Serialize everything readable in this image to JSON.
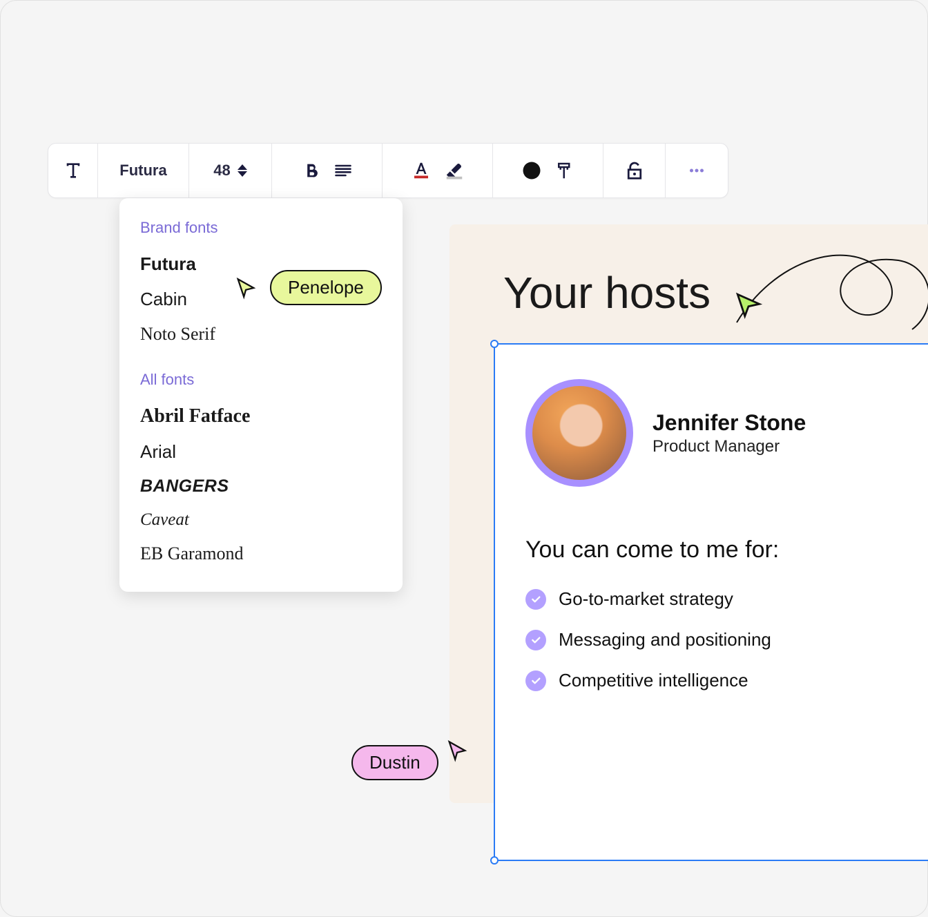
{
  "toolbar": {
    "font_label": "Futura",
    "font_size": "48"
  },
  "dropdown": {
    "brand_section": "Brand fonts",
    "brand_fonts": [
      "Futura",
      "Cabin",
      "Noto Serif"
    ],
    "all_section": "All fonts",
    "all_fonts": [
      "Abril Fatface",
      "Arial",
      "BANGERS",
      "Caveat",
      "EB Garamond"
    ]
  },
  "cursors": {
    "penelope": "Penelope",
    "dustin": "Dustin"
  },
  "canvas": {
    "title": "Your hosts",
    "host_name": "Jennifer Stone",
    "host_role": "Product Manager",
    "subhead": "You can come to me for:",
    "items": [
      "Go-to-market strategy",
      "Messaging and positioning",
      "Competitive intelligence"
    ]
  }
}
